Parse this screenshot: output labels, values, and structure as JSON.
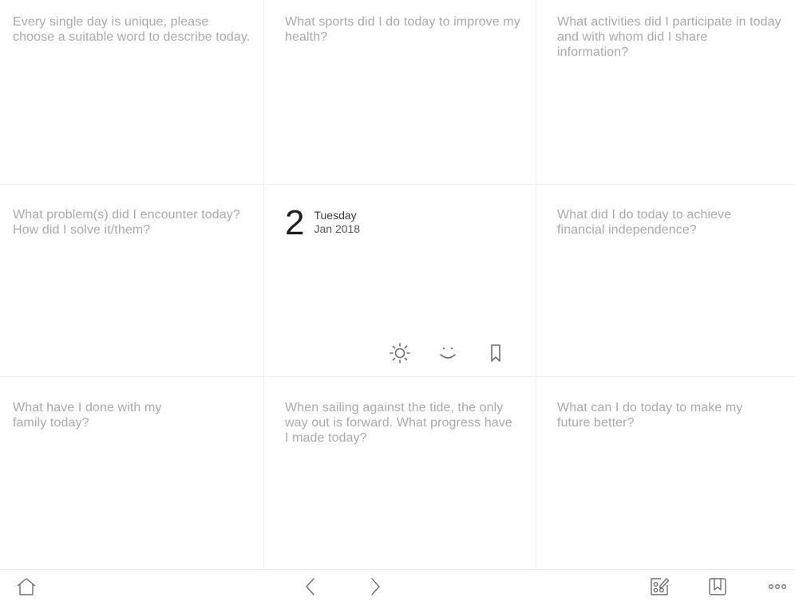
{
  "prompts": {
    "top_left": "Every single day is unique, please choose a suitable word to describe today.",
    "top_center": "What sports did I do today to improve my health?",
    "top_right": "What activities did I participate in today and with whom did I share information?",
    "middle_left": "What problem(s) did I encounter today? How did I solve it/them?",
    "middle_right": "What did I do today to achieve financial independence?",
    "bottom_left": "What have I done with my family today?",
    "bottom_center": "When sailing against the tide, the only way out is forward. What progress have I made today?",
    "bottom_right": "What can I do today to make my future better?"
  },
  "date": {
    "day": "2",
    "weekday": "Tuesday",
    "month_year": "Jan 2018"
  },
  "center_icons": [
    "weather-sun-icon",
    "mood-smile-icon",
    "bookmark-icon"
  ],
  "toolbar": {
    "left": [
      "home-icon"
    ],
    "center": [
      "chevron-left-icon",
      "chevron-right-icon"
    ],
    "right": [
      "template-edit-icon",
      "bookmark-box-icon",
      "more-icon"
    ]
  },
  "colors": {
    "prompt_text": "#a9a9a9",
    "date_text": "#1e1e1e",
    "icon_stroke": "#6e6e6e",
    "divider": "#f0f0f0"
  }
}
